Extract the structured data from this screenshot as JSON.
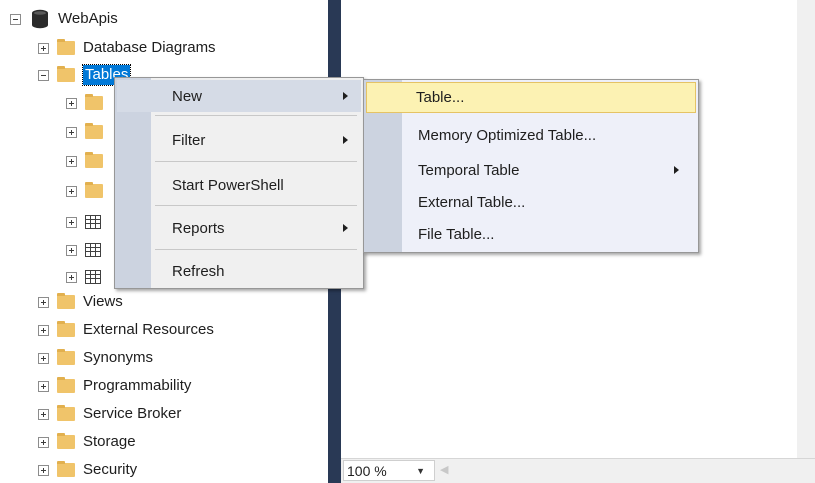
{
  "tree": {
    "root": "WebApis",
    "items": [
      {
        "label": "Database Diagrams"
      },
      {
        "label": "Tables"
      },
      {
        "label": ""
      },
      {
        "label": ""
      },
      {
        "label": ""
      },
      {
        "label": ""
      },
      {
        "label": ""
      },
      {
        "label": ""
      },
      {
        "label": ""
      },
      {
        "label": "Views"
      },
      {
        "label": "External Resources"
      },
      {
        "label": "Synonyms"
      },
      {
        "label": "Programmability"
      },
      {
        "label": "Service Broker"
      },
      {
        "label": "Storage"
      },
      {
        "label": "Security"
      }
    ]
  },
  "context_menu": {
    "items": [
      "New",
      "Filter",
      "Start PowerShell",
      "Reports",
      "Refresh"
    ]
  },
  "submenu": {
    "items": [
      "Table...",
      "Memory Optimized Table...",
      "Temporal Table",
      "External Table...",
      "File Table..."
    ]
  },
  "statusbar": {
    "zoom": "100 %"
  },
  "colors": {
    "splitter": "#293955",
    "highlight": "#fcf2b3",
    "selection": "#0078d7"
  }
}
